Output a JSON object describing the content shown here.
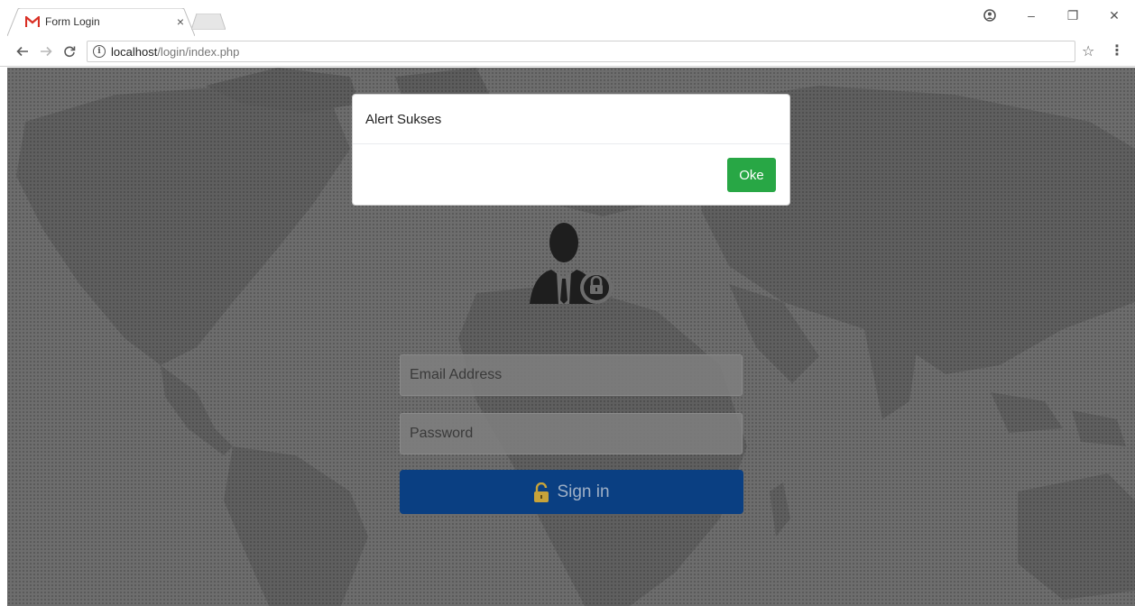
{
  "browser": {
    "tab_title": "Form Login",
    "tab_close": "×",
    "url_host": "localhost",
    "url_path": "/login/index.php",
    "icons": {
      "favicon": "gmail-icon",
      "back": "arrow-left-icon",
      "forward": "arrow-right-icon",
      "reload": "reload-icon",
      "info": "info-icon",
      "bookmark": "star-icon",
      "menu": "more-vert-icon",
      "profile": "profile-icon"
    }
  },
  "window_controls": {
    "minimize": "–",
    "restore": "❐",
    "close": "✕"
  },
  "modal": {
    "title": "Alert Sukses",
    "ok_label": "Oke"
  },
  "login": {
    "email_placeholder": "Email Address",
    "password_placeholder": "Password",
    "signin_label": "Sign in"
  },
  "colors": {
    "signin_button": "#0a3f82",
    "ok_button": "#28a745",
    "backdrop": "#6f6f6f",
    "gmail_red": "#d93025"
  }
}
